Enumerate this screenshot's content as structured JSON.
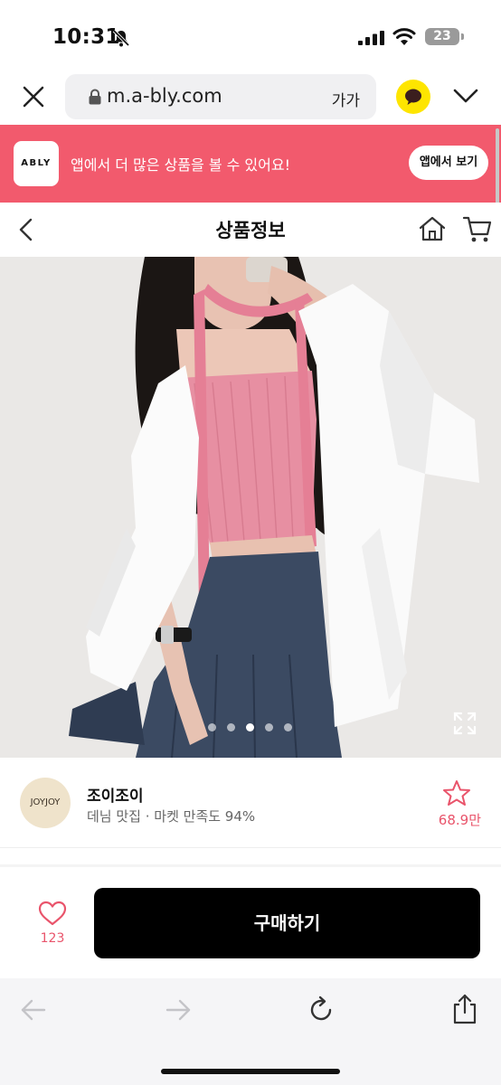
{
  "status_bar": {
    "time": "10:31",
    "battery": "23",
    "icons": [
      "bell-slash-icon",
      "signal-icon",
      "wifi-icon",
      "battery-icon"
    ]
  },
  "browser": {
    "url": "m.a-bly.com",
    "text_size_label": "가가",
    "icons": [
      "close-icon",
      "lock-icon",
      "kakao-talk-icon",
      "chevron-down-icon"
    ]
  },
  "app_banner": {
    "logo": "ABLY",
    "message": "앱에서 더 많은 상품을 볼 수 있어요!",
    "button": "앱에서 보기",
    "color": "#f25a6d"
  },
  "header": {
    "title": "상품정보",
    "icons": [
      "back-icon",
      "home-icon",
      "cart-icon"
    ]
  },
  "carousel": {
    "slide_count": 5,
    "active_index": 2
  },
  "shop": {
    "logo_text": "JOYJOY",
    "name": "조이조이",
    "description": "데님 맛집 · 마켓 만족도 94%",
    "favorite_count": "68.9만",
    "accent": "#e9546b"
  },
  "purchase": {
    "like_count": "123",
    "buy_label": "구매하기"
  },
  "toolbar": {
    "icons": [
      "back-arrow-icon",
      "forward-arrow-icon",
      "reload-icon",
      "share-icon"
    ]
  }
}
